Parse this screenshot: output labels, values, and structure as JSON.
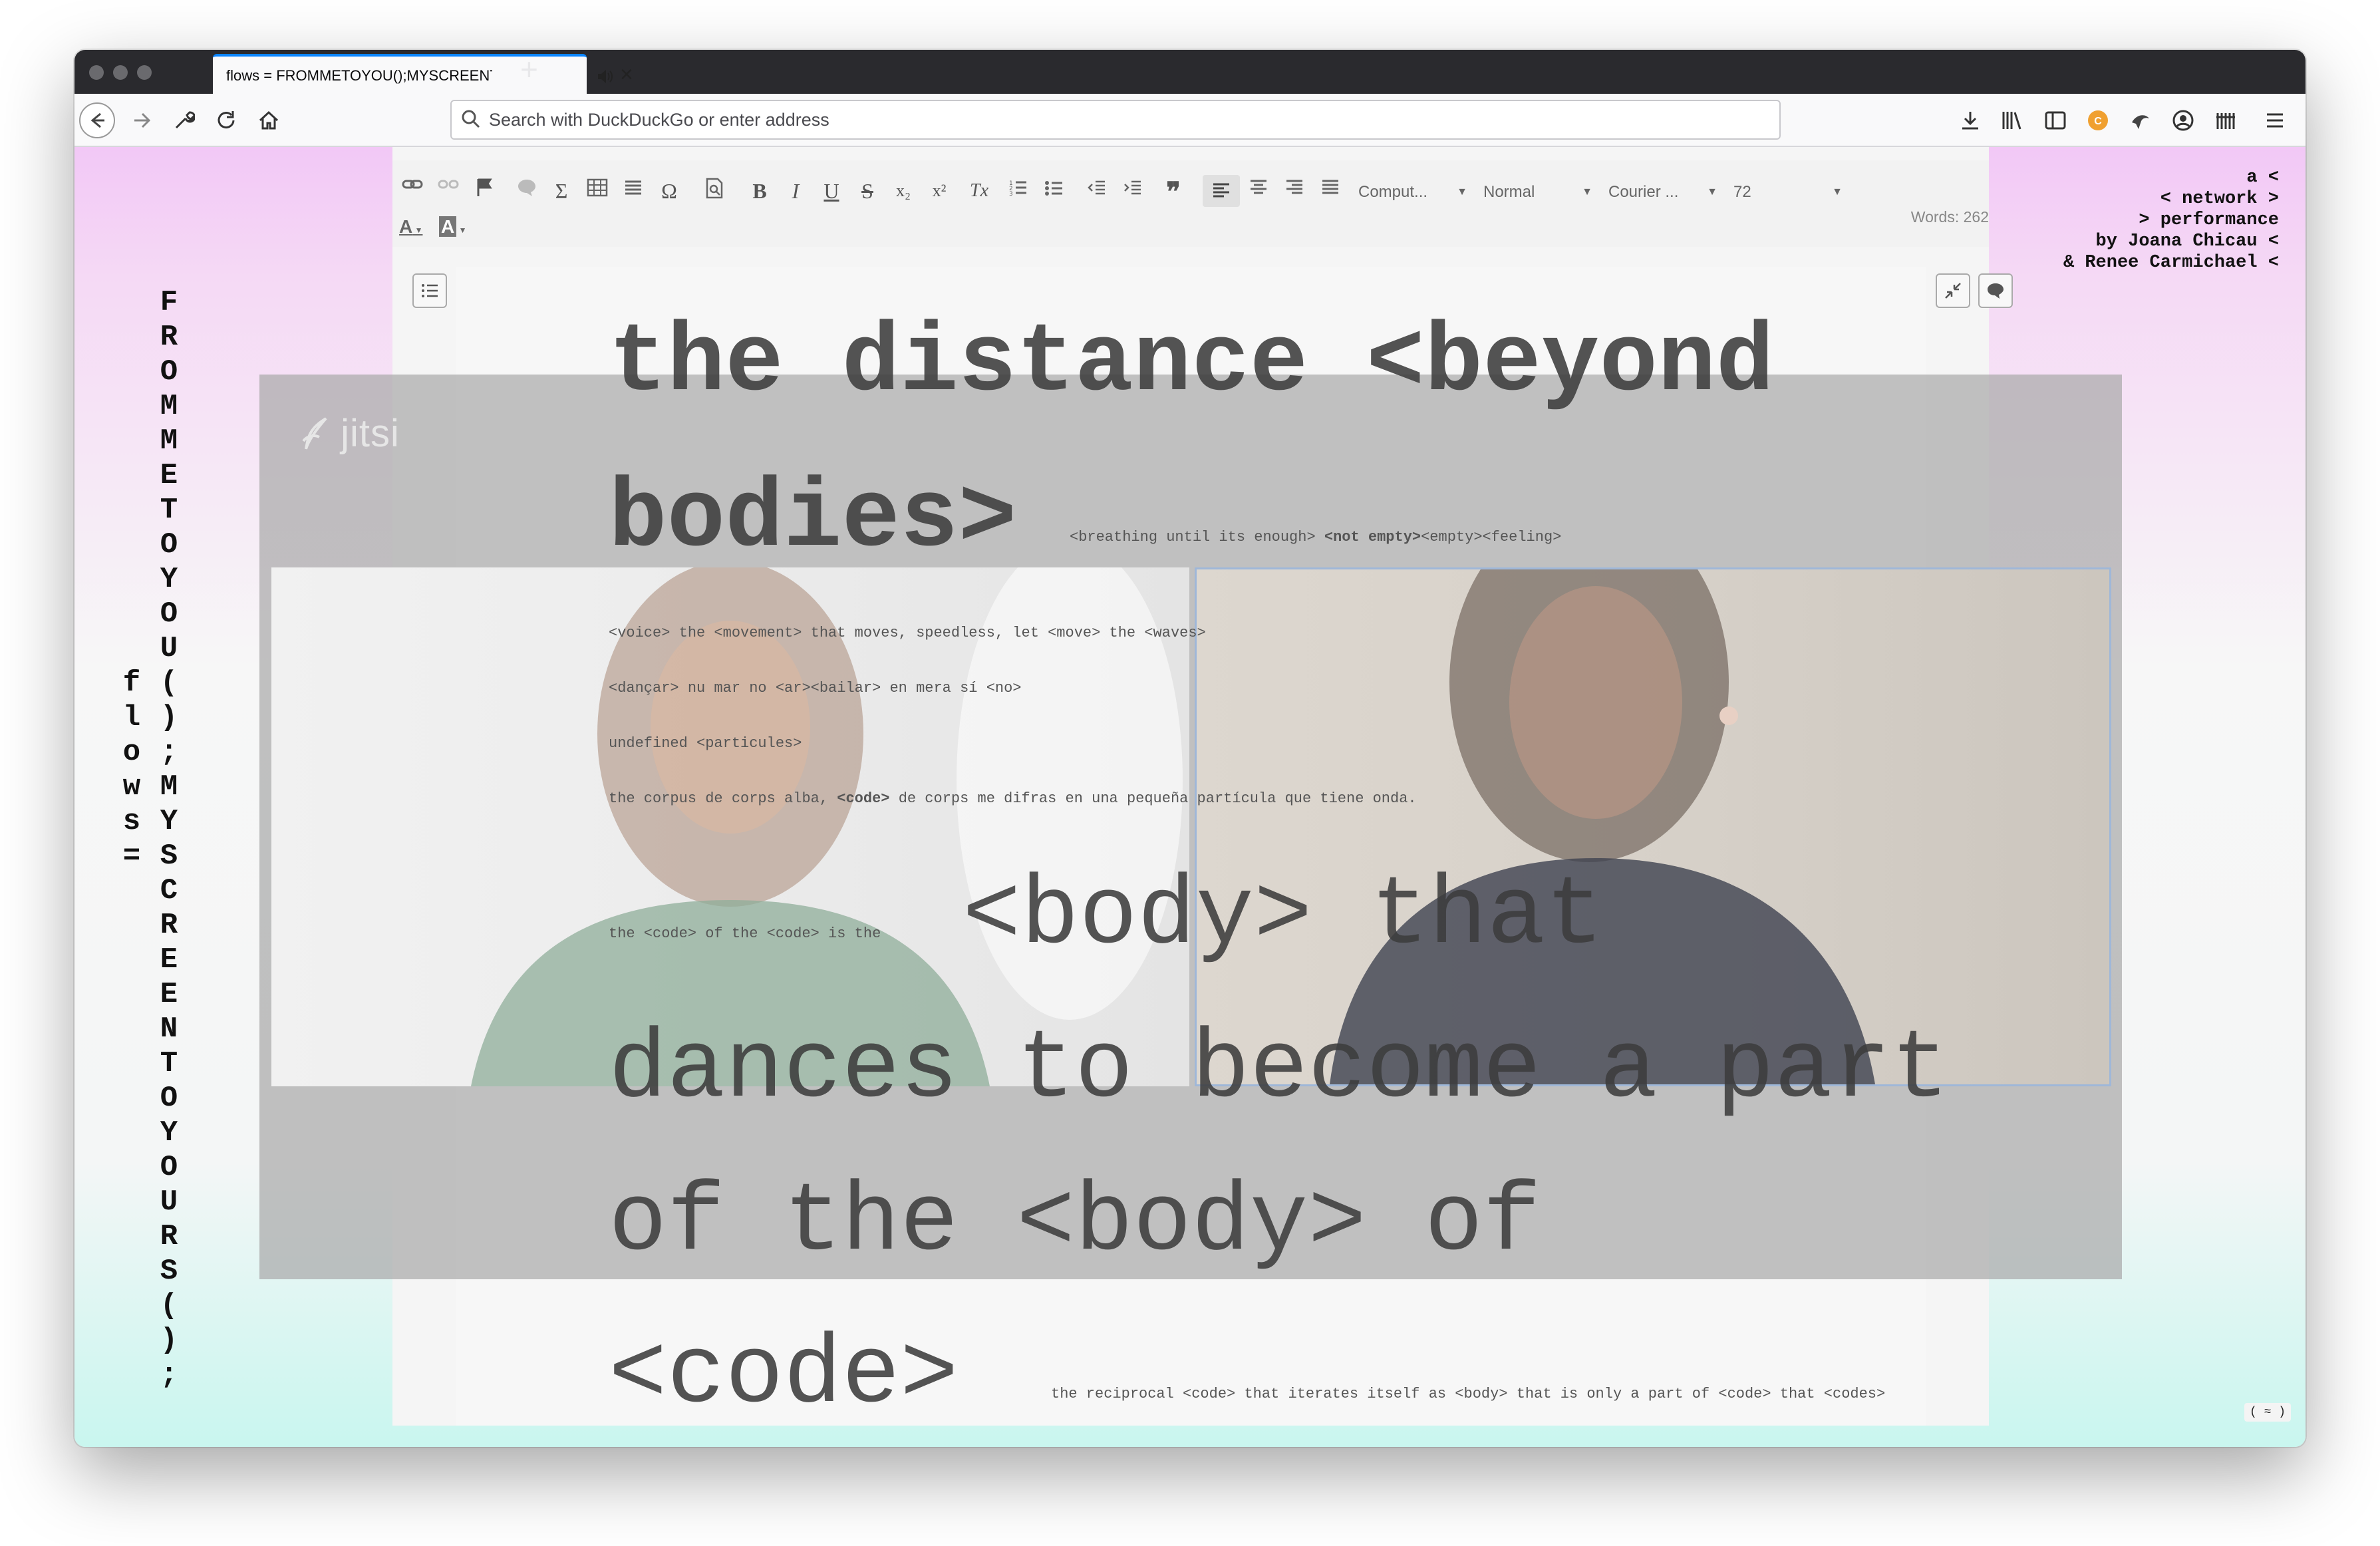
{
  "browser": {
    "tab_title": "flows = FROMMETOYOU();MYSCREENTOYOURS();",
    "url_placeholder": "Search with DuckDuckGo or enter address"
  },
  "page": {
    "vertical_title_left": "flows =",
    "vertical_title_right": "FROMMETOYOU();MYSCREENTOYOURS();",
    "credits": [
      "a <",
      "< network >",
      "> performance",
      "by Joana Chicau <",
      "& Renee Carmichael <"
    ],
    "bottom_button": "( ≈ )"
  },
  "editor": {
    "toolbar": {
      "font_family": "Comput...",
      "format": "Normal",
      "font_face": "Courier ...",
      "font_size": "72",
      "bold": "B",
      "italic": "I",
      "underline": "U",
      "strike": "S",
      "subscript": "x₂",
      "superscript": "x²",
      "clear_format": "Tx",
      "omega": "Ω",
      "sigma": "Σ",
      "quote": "❞",
      "font_color": "A",
      "bg_color": "A"
    },
    "word_count": "Words: 262"
  },
  "jitsi": {
    "logo": "jitsi"
  },
  "text": {
    "heading_line1": "the distance <beyond",
    "heading_line2": "bodies>",
    "breathing_pre": "<breathing until its enough>",
    "breathing_bold": "<not empty>",
    "breathing_post": "<empty><feeling>",
    "line_voice": "<voice> the <movement> that moves, speedless, let <move> the <waves>",
    "line_dancar": "<dançar> nu mar no <ar><bailar> en mera sí <no>",
    "line_undefined": "undefined <particules>",
    "line_corpus_pre": "the corpus de corps alba,",
    "line_corpus_bold": "<code>",
    "line_corpus_post": "de corps me difras en una pequeña partícula que tiene onda.",
    "line_code_of_code": "the <code> of the <code> is the",
    "big_body_that": "<body> that",
    "big_dances": "dances to become a part",
    "big_of_the_body": "of the <body> of",
    "big_code": "<code>",
    "line_reciprocal": "the reciprocal <code> that iterates itself as <body> that is only a part of <code> that <codes>"
  }
}
